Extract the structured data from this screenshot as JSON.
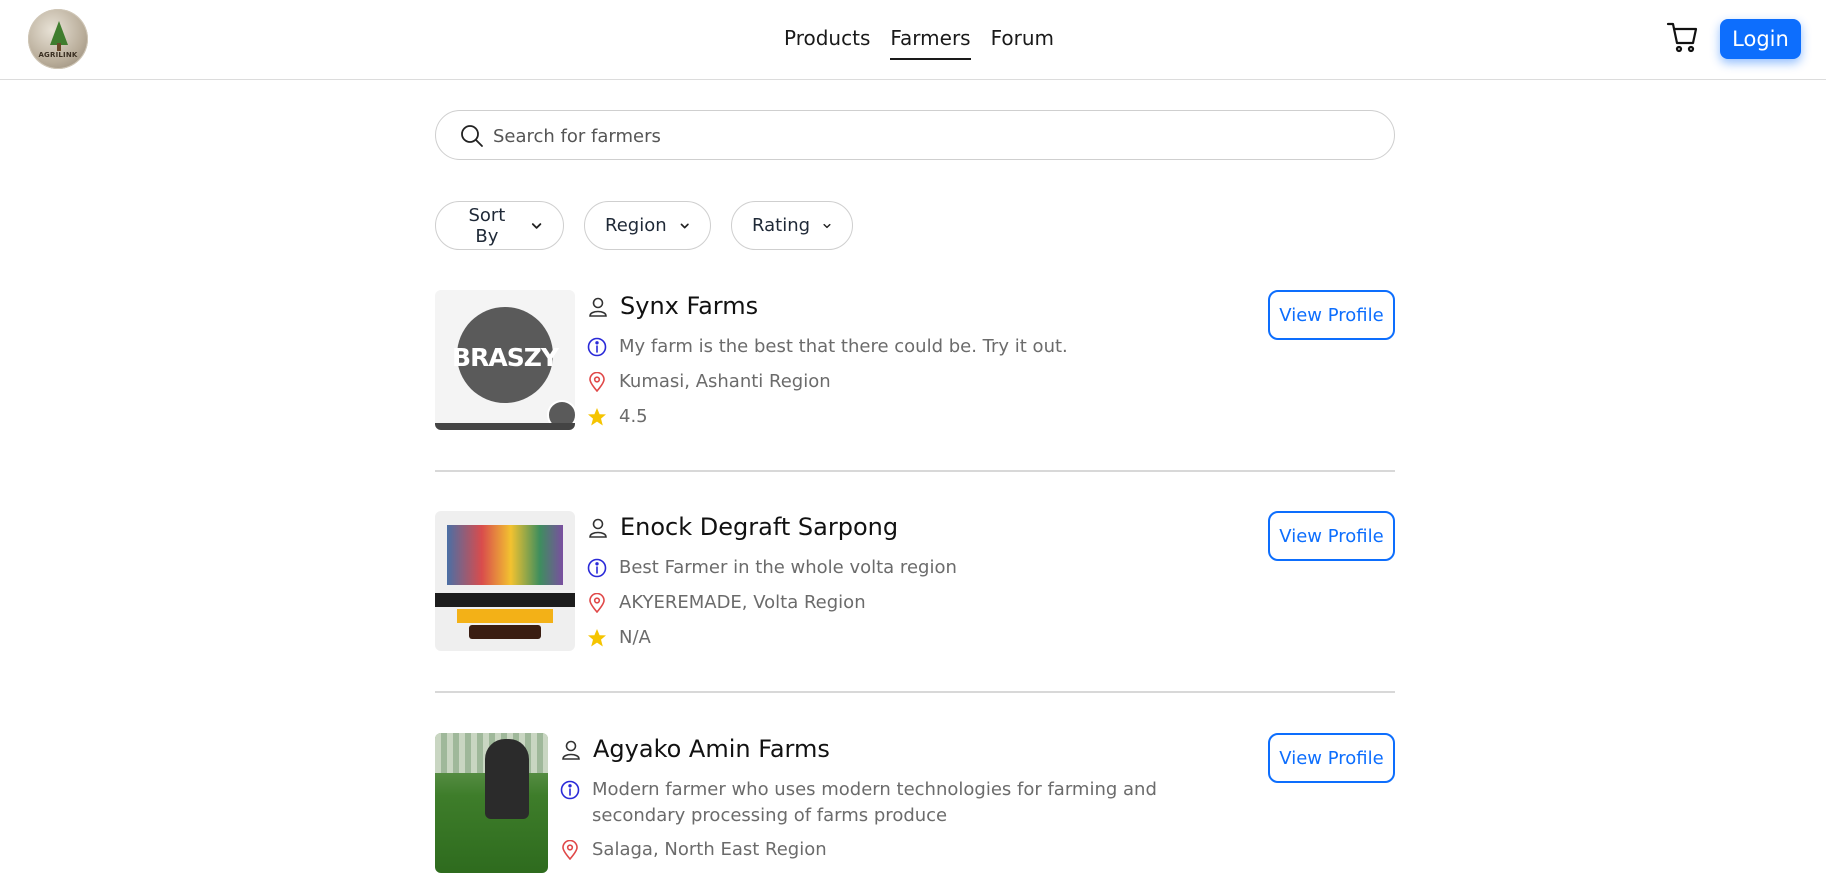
{
  "brand": {
    "logo_text": "AGRILINK"
  },
  "nav": {
    "links": [
      {
        "label": "Products",
        "active": false
      },
      {
        "label": "Farmers",
        "active": true
      },
      {
        "label": "Forum",
        "active": false
      }
    ],
    "cart_icon": "cart-icon",
    "login_label": "Login"
  },
  "search": {
    "placeholder": "Search for farmers",
    "icon": "search-icon"
  },
  "filters": [
    {
      "label": "Sort By"
    },
    {
      "label": "Region"
    },
    {
      "label": "Rating"
    }
  ],
  "farmers": [
    {
      "name": "Synx Farms",
      "description": "My farm is the best that there could be. Try it out.",
      "location": "Kumasi, Ashanti Region",
      "rating": "4.5",
      "image_text": "BRASZY",
      "button_label": "View Profile"
    },
    {
      "name": "Enock Degraft Sarpong",
      "description": "Best Farmer in the whole volta region",
      "location": "AKYEREMADE, Volta Region",
      "rating": "N/A",
      "button_label": "View Profile"
    },
    {
      "name": "Agyako Amin Farms",
      "description": "Modern farmer who uses modern technologies for farming and secondary processing of farms produce",
      "location": "Salaga, North East Region",
      "button_label": "View Profile"
    }
  ],
  "colors": {
    "primary": "#0d6efd",
    "info_icon": "#2a2ad8",
    "location_icon": "#e04848",
    "star": "#f5c400"
  }
}
